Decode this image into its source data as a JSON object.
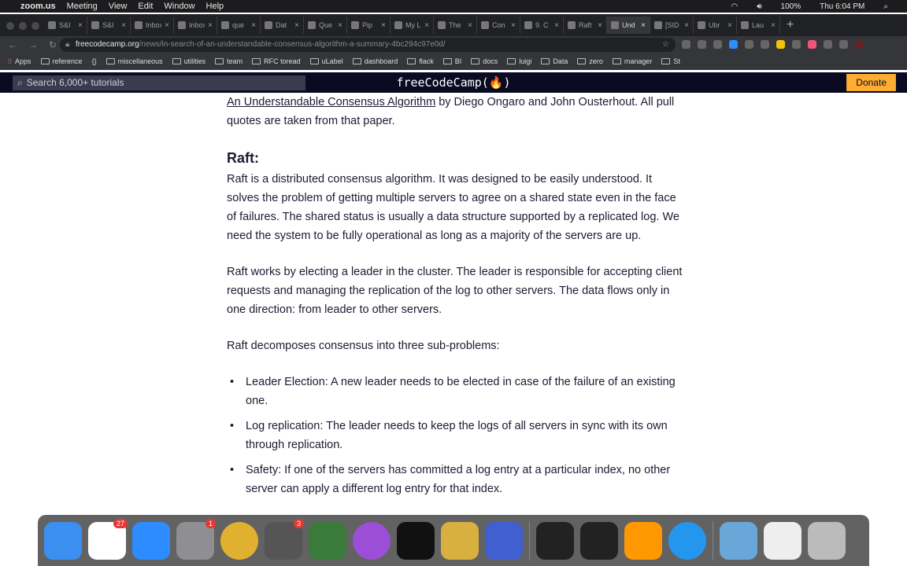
{
  "menubar": {
    "app": "zoom.us",
    "items": [
      "Meeting",
      "View",
      "Edit",
      "Window",
      "Help"
    ],
    "battery": "100%",
    "clock": "Thu 6:04 PM"
  },
  "tabs": [
    {
      "label": "S&I"
    },
    {
      "label": "S&I"
    },
    {
      "label": "Inbox"
    },
    {
      "label": "Inbox"
    },
    {
      "label": "que"
    },
    {
      "label": "Dat"
    },
    {
      "label": "Que"
    },
    {
      "label": "Pip"
    },
    {
      "label": "My L"
    },
    {
      "label": "The"
    },
    {
      "label": "Con"
    },
    {
      "label": "9. C"
    },
    {
      "label": "Raft"
    },
    {
      "label": "Und",
      "active": true
    },
    {
      "label": "[SID"
    },
    {
      "label": "Ubr"
    },
    {
      "label": "Lau"
    }
  ],
  "address": {
    "domain": "freecodecamp.org",
    "path": "/news/in-search-of-an-understandable-consensus-algorithm-a-summary-4bc294c97e0d/"
  },
  "bookmarks": [
    "Apps",
    "reference",
    "{}",
    "miscellaneous",
    "utilities",
    "team",
    "RFC toread",
    "uLabel",
    "dashboard",
    "flack",
    "BI",
    "docs",
    "luigi",
    "Data",
    "zero",
    "manager",
    "St"
  ],
  "fcc": {
    "search_placeholder": "Search 6,000+ tutorials",
    "logo": "freeCodeCamp(🔥)",
    "donate": "Donate"
  },
  "article": {
    "intro_link": "An Understandable Consensus Algorithm",
    "intro_rest": " by Diego Ongaro and John Ousterhout. All pull quotes are taken from that paper.",
    "heading": "Raft:",
    "p1": "Raft is a distributed consensus algorithm. It was designed to be easily understood. It solves the problem of getting multiple servers to agree on a shared state even in the face of failures. The shared status is usually a data structure supported by a replicated log. We need the system to be fully operational as long as a majority of the servers are up.",
    "p2": "Raft works by electing a leader in the cluster. The leader is responsible for accepting client requests and managing the replication of the log to other servers. The data flows only in one direction: from leader to other servers.",
    "p3": "Raft decomposes consensus into three sub-problems:",
    "bullets": [
      "Leader Election: A new leader needs to be elected in case of the failure of an existing one.",
      "Log replication: The leader needs to keep the logs of all servers in sync with its own through replication.",
      "Safety: If one of the servers has committed a log entry at a particular index, no other server can apply a different log entry for that index."
    ]
  },
  "dock": [
    {
      "name": "finder",
      "color": "#3b8ff0"
    },
    {
      "name": "slack",
      "color": "#fff",
      "badge": "27"
    },
    {
      "name": "zoom",
      "color": "#2d8cff"
    },
    {
      "name": "system-preferences",
      "color": "#8e8e93",
      "badge": "1"
    },
    {
      "name": "chrome",
      "color": "#e0b030"
    },
    {
      "name": "app-store",
      "color": "#555",
      "badge": "3"
    },
    {
      "name": "app",
      "color": "#3a7a3a"
    },
    {
      "name": "podcasts",
      "color": "#9b4fd6"
    },
    {
      "name": "apple-tv",
      "color": "#111"
    },
    {
      "name": "database",
      "color": "#d8b040"
    },
    {
      "name": "goland",
      "color": "#4060d0"
    },
    {
      "name": "terminal",
      "color": "#222"
    },
    {
      "name": "activity-monitor",
      "color": "#222"
    },
    {
      "name": "sublime-text",
      "color": "#ff9800"
    },
    {
      "name": "docker",
      "color": "#2496ed"
    },
    {
      "name": "downloads",
      "color": "#6aa6d8"
    },
    {
      "name": "preview",
      "color": "#eee"
    },
    {
      "name": "trash",
      "color": "#bbb"
    }
  ]
}
